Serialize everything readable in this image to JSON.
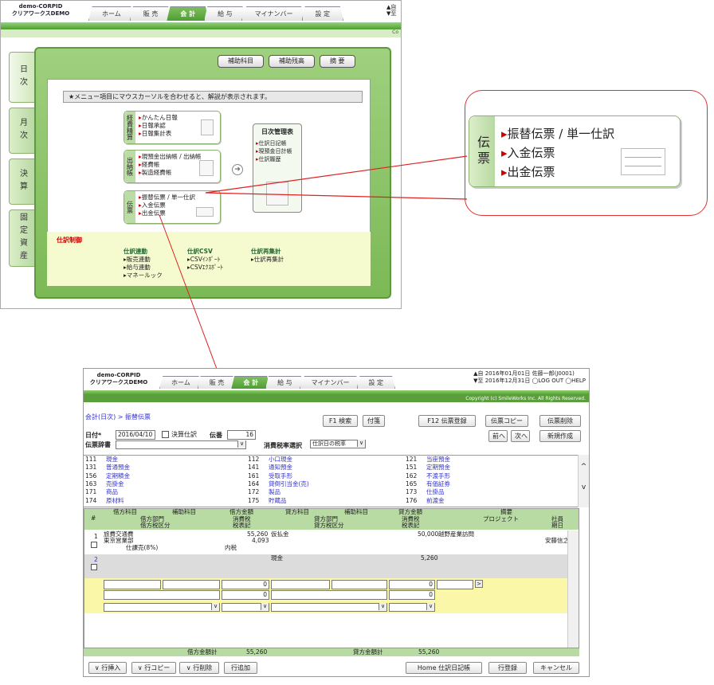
{
  "top": {
    "logo": [
      "demo-CORPID",
      "クリアワークスDEMO"
    ],
    "tabs": [
      "ホーム",
      "販 売",
      "会 計",
      "給 与",
      "マイナンバー",
      "設 定"
    ],
    "active_tab": 2,
    "corner": "▲自\n▼至",
    "corner_small": "Co",
    "side_tabs": [
      "日次",
      "月次",
      "決算",
      "固定資産"
    ],
    "buttons": [
      "補助科目",
      "補助残高",
      "摘 要"
    ],
    "info": "★メニュー項目にマウスカーソルを合わせると、解説が表示されます。",
    "keihi": {
      "label": "経費精算",
      "items": [
        "かんたん日報",
        "日報承認",
        "日報集計表"
      ]
    },
    "suitou": {
      "label": "出納帳",
      "items": [
        "現預金出納帳 / 出納帳",
        "経費帳",
        "製造経費帳"
      ]
    },
    "denpyo": {
      "label": "伝票",
      "items": [
        "振替伝票 / 単一仕訳",
        "入金伝票",
        "出金伝票"
      ]
    },
    "nichiji": {
      "title": "日次管理表",
      "items": [
        "仕訳日記帳",
        "現預金日計帳",
        "仕訳履歴"
      ]
    },
    "shiwake_title": "仕訳制御",
    "shiwake_cols": [
      {
        "title": "仕訳連動",
        "items": [
          "販売連動",
          "給与連動",
          "マネールック"
        ]
      },
      {
        "title": "仕訳CSV",
        "items": [
          "CSVｲﾝﾎﾟｰﾄ",
          "CSVｴｸｽﾎﾟｰﾄ"
        ]
      },
      {
        "title": "仕訳再集計",
        "items": [
          "仕訳再集計"
        ]
      }
    ]
  },
  "zoom": {
    "label": "伝票",
    "items": [
      "振替伝票 / 単一仕訳",
      "入金伝票",
      "出金伝票"
    ]
  },
  "bottom": {
    "logo": [
      "demo-CORPID",
      "クリアワークスDEMO"
    ],
    "tabs": [
      "ホーム",
      "販 売",
      "会 計",
      "給 与",
      "マイナンバー",
      "設 定"
    ],
    "header_info": [
      "▲自 2016年01月01日 佐藤一郎(J0001)",
      "▼至 2016年12月31日 ◯LOG OUT ◯HELP"
    ],
    "copyright": "Copyright (c) SmileWorks Inc. All Rights Reserved.",
    "breadcrumb": "会計(日次) > 振替伝票",
    "btn_f1": "F1 検索",
    "btn_fusen": "付箋",
    "btn_f12": "F12 伝票登録",
    "btn_copy": "伝票コピー",
    "btn_delete": "伝票削除",
    "btn_prev": "前へ",
    "btn_next": "次へ",
    "btn_new": "新規作成",
    "date_label": "日付*",
    "date_value": "2016/04/10",
    "kessan_label": "決算仕訳",
    "denban_label": "伝番",
    "denban_value": "16",
    "jisho_label": "伝票辞書",
    "tax_label": "消費税率選択",
    "tax_value": "仕訳日の税率",
    "accounts": [
      [
        "111",
        "現金",
        "112",
        "小口現金",
        "121",
        "当座預金"
      ],
      [
        "131",
        "普通預金",
        "141",
        "通知預金",
        "151",
        "定期預金"
      ],
      [
        "156",
        "定期積金",
        "161",
        "受取手形",
        "162",
        "不渡手形"
      ],
      [
        "163",
        "売掛金",
        "164",
        "貸倒引当金(売)",
        "165",
        "有価証券"
      ],
      [
        "171",
        "商品",
        "172",
        "製品",
        "173",
        "仕掛品"
      ],
      [
        "174",
        "原材料",
        "175",
        "貯蔵品",
        "176",
        "前渡金"
      ]
    ],
    "head": {
      "no": "#",
      "debit_acc": "借方科目",
      "debit_sub": "補助科目",
      "debit_amt": "借方金額",
      "debit_dept": "借方部門",
      "debit_tax": "消費税",
      "debit_taxcls": "借方税区分",
      "debit_taxmark": "税表記",
      "credit_acc": "貸方科目",
      "credit_sub": "補助科目",
      "credit_amt": "貸方金額",
      "credit_dept": "貸方部門",
      "credit_tax": "消費税",
      "credit_taxcls": "貸方税区分",
      "credit_taxmark": "税表記",
      "memo": "摘要",
      "project": "プロジェクト",
      "staff": "社員",
      "due": "期日"
    },
    "row1": {
      "no": "1",
      "debit_acc": "旅費交通費",
      "debit_amt": "55,260",
      "debit_dept": "東京営業部",
      "debit_tax": "4,093",
      "debit_taxcls": "仕課売(8%)",
      "debit_taxmark": "内税",
      "credit_acc": "仮払金",
      "credit_amt": "50,000",
      "memo": "越野産業訪問",
      "staff": "安藤信之"
    },
    "row2": {
      "no": "2",
      "credit_acc": "現金",
      "credit_amt": "5,260"
    },
    "zero": "0",
    "debit_total_label": "借方金額計",
    "debit_total": "55,260",
    "credit_total_label": "貸方金額計",
    "credit_total": "55,260",
    "bottom_btns": [
      "∨ 行挿入",
      "∨ 行コピー",
      "∨ 行削除",
      "行追加"
    ],
    "btn_home": "Home 仕訳日記帳",
    "btn_rowreg": "行登録",
    "btn_cancel": "キャンセル"
  }
}
